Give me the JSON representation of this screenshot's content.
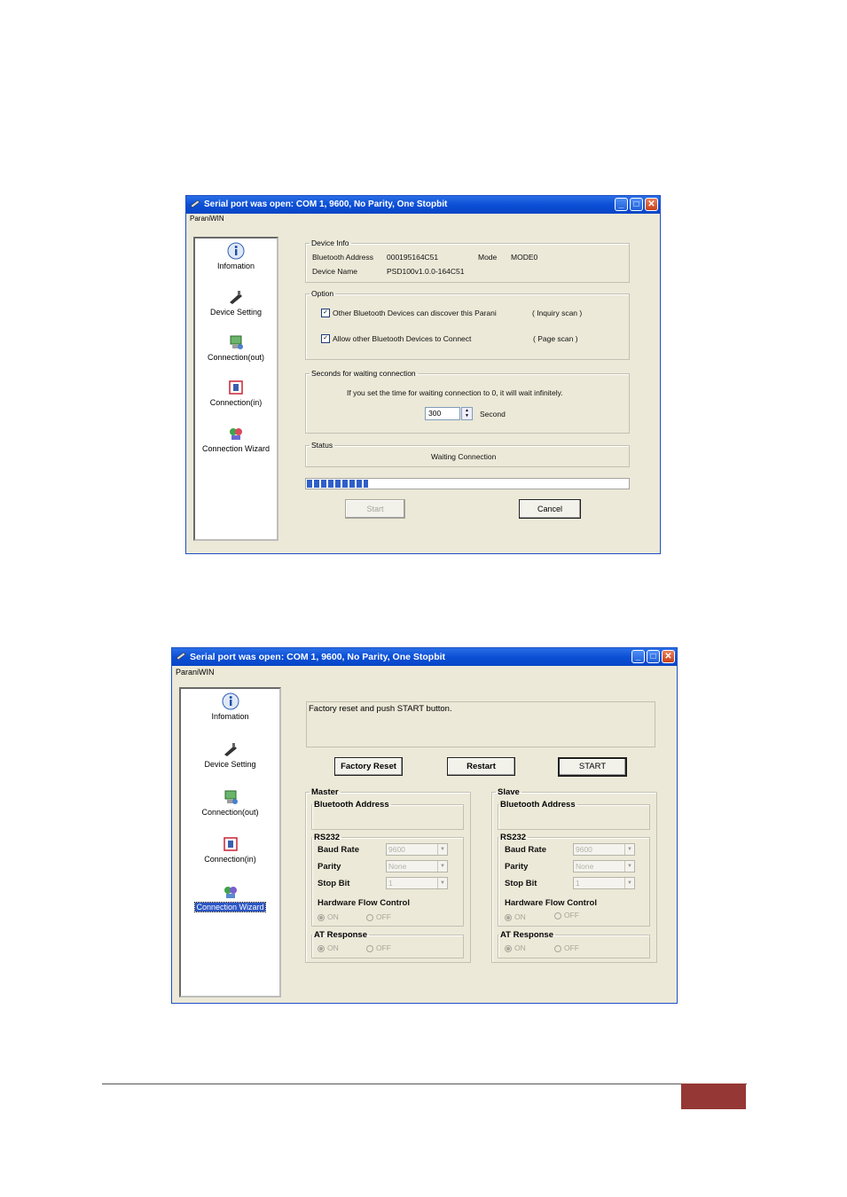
{
  "window1": {
    "title": "Serial port was open: COM 1, 9600, No Parity, One Stopbit",
    "menu": "ParaniWIN",
    "sidebar": [
      {
        "label": "Infomation",
        "icon": "info-icon"
      },
      {
        "label": "Device Setting",
        "icon": "device-icon"
      },
      {
        "label": "Connection(out)",
        "icon": "connection-out-icon"
      },
      {
        "label": "Connection(in)",
        "icon": "connection-in-icon"
      },
      {
        "label": "Connection Wizard",
        "icon": "wizard-icon"
      }
    ],
    "device_info": {
      "legend": "Device Info",
      "bt_label": "Bluetooth Address",
      "bt_value": "000195164C51",
      "mode_label": "Mode",
      "mode_value": "MODE0",
      "name_label": "Device Name",
      "name_value": "PSD100v1.0.0-164C51"
    },
    "option": {
      "legend": "Option",
      "opt1": "Other Bluetooth Devices can discover this Parani",
      "opt1_note": "( Inquiry scan )",
      "opt1_checked": true,
      "opt2": "Allow other Bluetooth Devices to Connect",
      "opt2_note": "( Page scan )",
      "opt2_checked": true
    },
    "waiting": {
      "legend": "Seconds for waiting connection",
      "info": "If you set the time for waiting connection to 0, it will wait infinitely.",
      "value": "300",
      "unit": "Second"
    },
    "status": {
      "legend": "Status",
      "text": "Waiting Connection"
    },
    "progress": 0.19,
    "start_label": "Start",
    "cancel_label": "Cancel"
  },
  "window2": {
    "title": "Serial port was open: COM 1, 9600, No Parity, One Stopbit",
    "menu": "ParaniWIN",
    "sidebar": [
      {
        "label": "Infomation",
        "icon": "info-icon"
      },
      {
        "label": "Device Setting",
        "icon": "device-icon"
      },
      {
        "label": "Connection(out)",
        "icon": "connection-out-icon"
      },
      {
        "label": "Connection(in)",
        "icon": "connection-in-icon"
      },
      {
        "label": "Connection Wizard",
        "icon": "wizard-icon"
      }
    ],
    "message": "Factory reset and push START button.",
    "factory_reset_label": "Factory Reset",
    "restart_label": "Restart",
    "start_label": "START",
    "master": {
      "legend": "Master",
      "bt_legend": "Bluetooth Address",
      "rs232_legend": "RS232",
      "baud_label": "Baud Rate",
      "baud_value": "9600",
      "parity_label": "Parity",
      "parity_value": "None",
      "stop_label": "Stop Bit",
      "stop_value": "1",
      "hfc_label": "Hardware Flow Control",
      "on_label": "ON",
      "off_label": "OFF",
      "at_legend": "AT Response"
    },
    "slave": {
      "legend": "Slave",
      "bt_legend": "Bluetooth Address",
      "rs232_legend": "RS232",
      "baud_label": "Baud Rate",
      "baud_value": "9600",
      "parity_label": "Parity",
      "parity_value": "None",
      "stop_label": "Stop Bit",
      "stop_value": "1",
      "hfc_label": "Hardware Flow Control",
      "on_label": "ON",
      "off_label": "OFF",
      "at_legend": "AT Response"
    }
  },
  "colors": {
    "titlebar": "#0b4fd6",
    "window_bg": "#ece9d8",
    "progress": "#2f5fc8",
    "footer_accent": "#953734"
  }
}
